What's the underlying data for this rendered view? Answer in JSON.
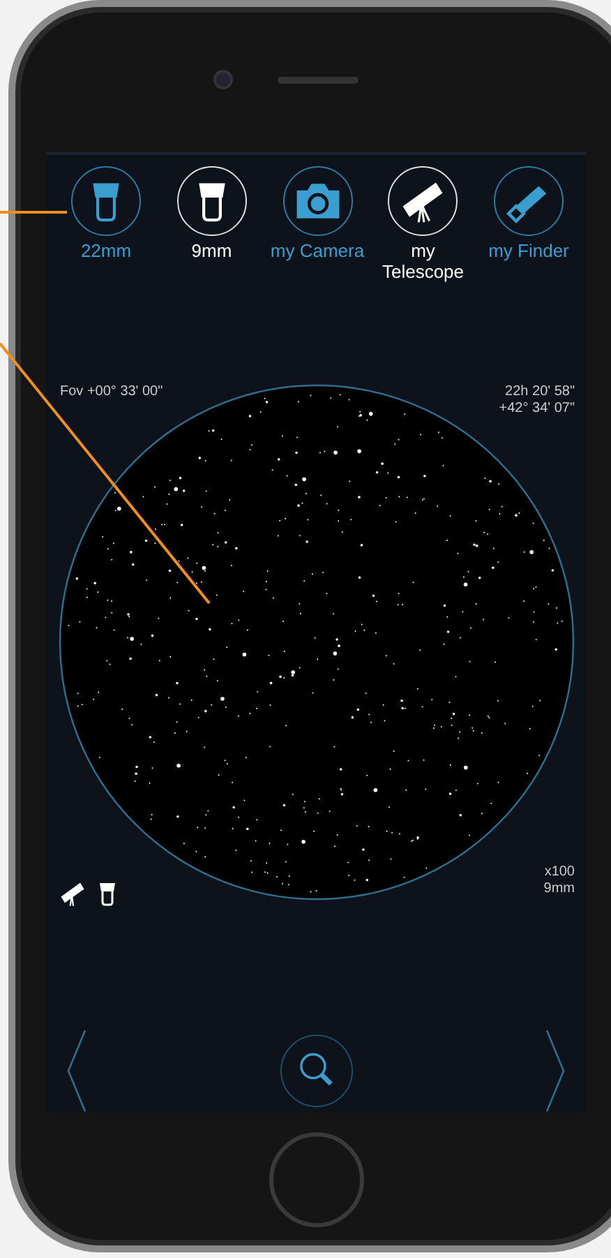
{
  "instruments": [
    {
      "label": "22mm",
      "kind": "eyepiece",
      "selected": false
    },
    {
      "label": "9mm",
      "kind": "eyepiece",
      "selected": true
    },
    {
      "label": "my Camera",
      "kind": "camera",
      "selected": false
    },
    {
      "label": "my Telescope",
      "kind": "telescope",
      "selected": true
    },
    {
      "label": "my Finder",
      "kind": "finder",
      "selected": false
    }
  ],
  "fov": "Fov +00° 33' 00\"",
  "coordinates": [
    "22h 20' 58\"",
    "+42° 34' 07\""
  ],
  "magnification": [
    "x100",
    "9mm"
  ]
}
